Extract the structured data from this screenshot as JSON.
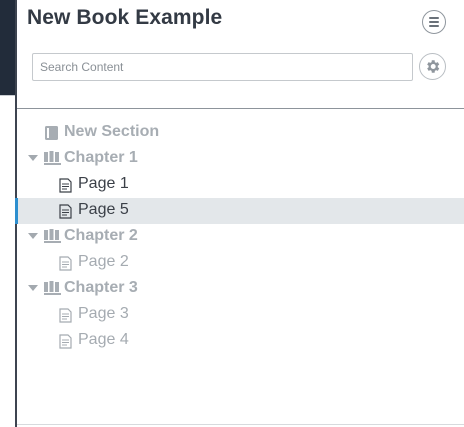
{
  "book": {
    "title": "New Book Example"
  },
  "search": {
    "placeholder": "Search Content"
  },
  "tree": {
    "new_section": "New Section",
    "chapters": [
      {
        "label": "Chapter 1",
        "pages": [
          "Page 1",
          "Page 5"
        ]
      },
      {
        "label": "Chapter 2",
        "pages": [
          "Page 2"
        ]
      },
      {
        "label": "Chapter 3",
        "pages": [
          "Page 3",
          "Page 4"
        ]
      }
    ],
    "selected_page": "Page 5"
  },
  "colors": {
    "accent": "#2d8fcf",
    "selected_row": "#e3e7ea",
    "heading_text": "#a7adb3",
    "dark_text": "#3b4048"
  },
  "icons": {
    "menu": "hamburger-menu-icon",
    "settings": "gear-icon",
    "section": "section-block-icon",
    "chapter": "books-icon",
    "page": "document-icon",
    "expand": "caret-down-icon"
  }
}
